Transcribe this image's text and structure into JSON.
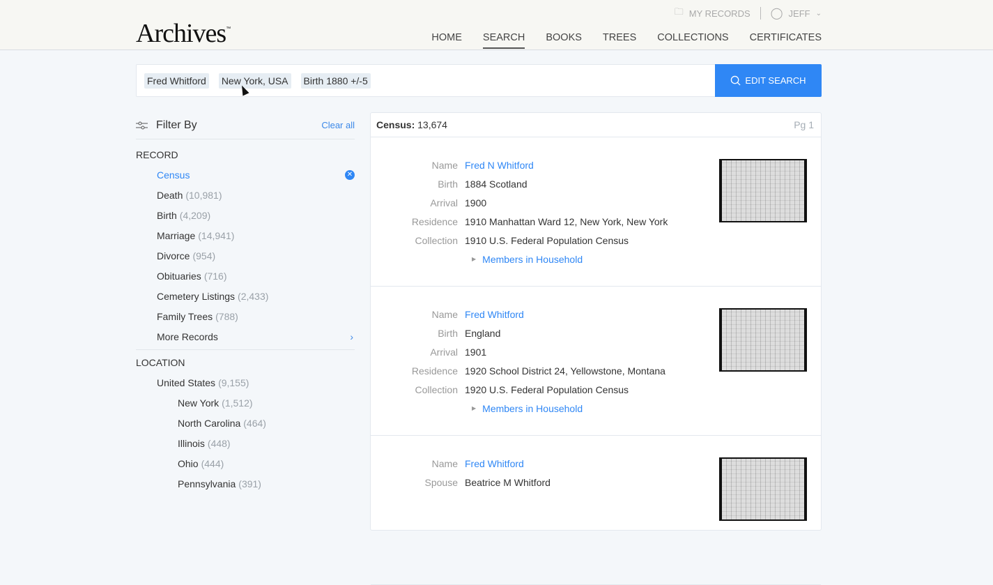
{
  "header": {
    "logo": "Archives",
    "tm": "™",
    "my_records": "MY RECORDS",
    "user": "JEFF",
    "nav": [
      "HOME",
      "SEARCH",
      "BOOKS",
      "TREES",
      "COLLECTIONS",
      "CERTIFICATES"
    ],
    "active_nav": "SEARCH"
  },
  "search": {
    "chips": [
      "Fred Whitford",
      "New York, USA",
      "Birth 1880 +/-5"
    ],
    "edit_label": "EDIT SEARCH"
  },
  "filter": {
    "title": "Filter By",
    "clear": "Clear all",
    "record_heading": "RECORD",
    "records": [
      {
        "label": "Census",
        "count": ""
      },
      {
        "label": "Death",
        "count": "(10,981)"
      },
      {
        "label": "Birth",
        "count": "(4,209)"
      },
      {
        "label": "Marriage",
        "count": "(14,941)"
      },
      {
        "label": "Divorce",
        "count": "(954)"
      },
      {
        "label": "Obituaries",
        "count": "(716)"
      },
      {
        "label": "Cemetery Listings",
        "count": "(2,433)"
      },
      {
        "label": "Family Trees",
        "count": "(788)"
      }
    ],
    "more": "More Records",
    "location_heading": "LOCATION",
    "country": {
      "label": "United States",
      "count": "(9,155)"
    },
    "states": [
      {
        "label": "New York",
        "count": "(1,512)"
      },
      {
        "label": "North Carolina",
        "count": "(464)"
      },
      {
        "label": "Illinois",
        "count": "(448)"
      },
      {
        "label": "Ohio",
        "count": "(444)"
      },
      {
        "label": "Pennsylvania",
        "count": "(391)"
      }
    ]
  },
  "results": {
    "label": "Census:",
    "count": "13,674",
    "page": "Pg 1",
    "members": "Members in Household",
    "records": [
      {
        "rows": [
          [
            "Name",
            "Fred N Whitford"
          ],
          [
            "Birth",
            "1884 Scotland"
          ],
          [
            "Arrival",
            "1900"
          ],
          [
            "Residence",
            "1910 Manhattan Ward 12, New York, New York"
          ],
          [
            "Collection",
            "1910 U.S. Federal Population Census"
          ]
        ]
      },
      {
        "rows": [
          [
            "Name",
            "Fred Whitford"
          ],
          [
            "Birth",
            "England"
          ],
          [
            "Arrival",
            "1901"
          ],
          [
            "Residence",
            "1920 School District 24, Yellowstone, Montana"
          ],
          [
            "Collection",
            "1920 U.S. Federal Population Census"
          ]
        ]
      },
      {
        "rows": [
          [
            "Name",
            "Fred Whitford"
          ],
          [
            "Spouse",
            "Beatrice M Whitford"
          ]
        ]
      }
    ]
  }
}
